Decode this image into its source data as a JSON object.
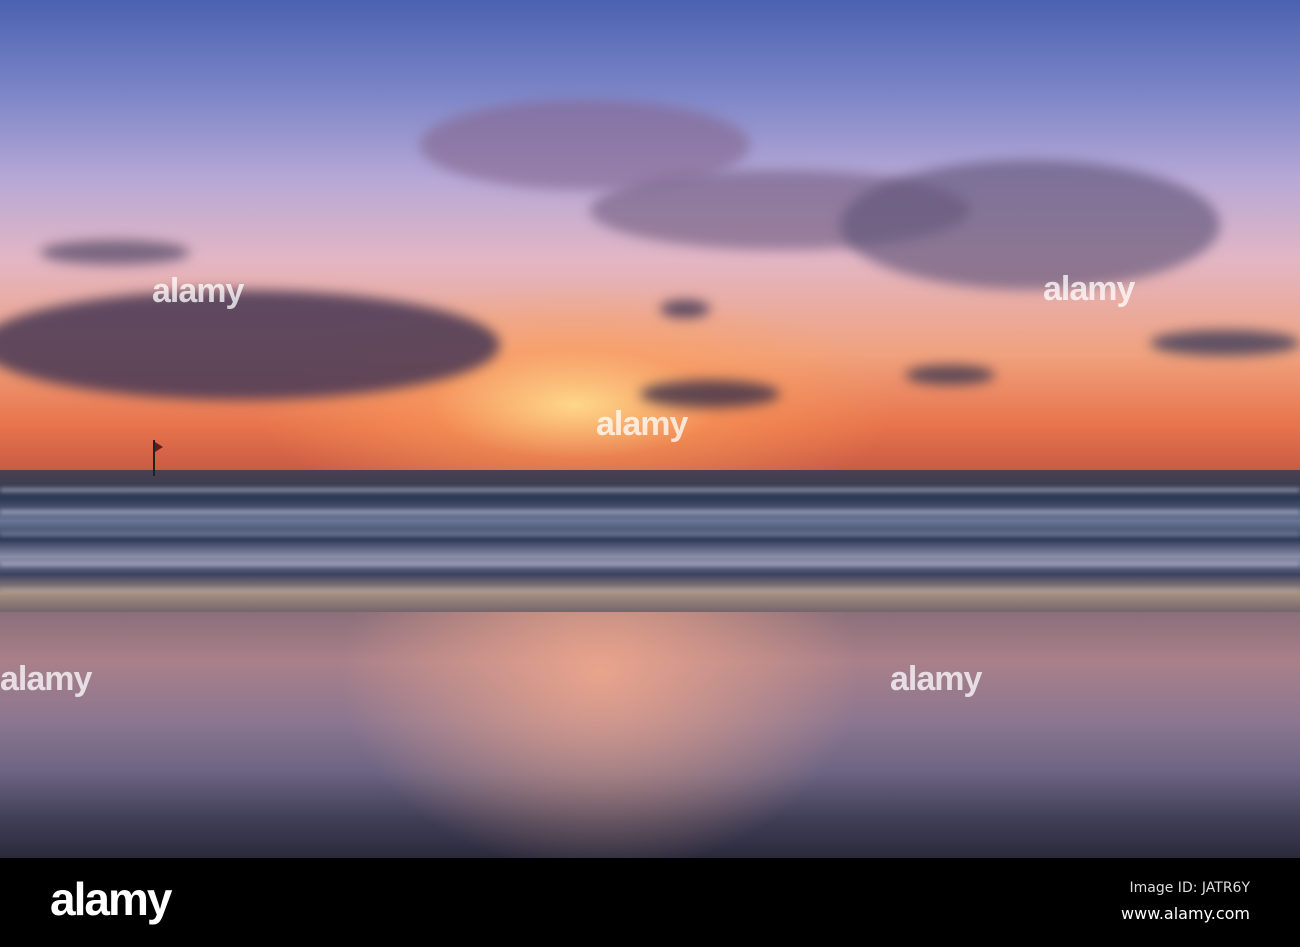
{
  "photo": {
    "subject": "Sunset over ocean beach with reflections",
    "watermark_text": "alamy"
  },
  "footer": {
    "logo": "alamy",
    "image_id": "Image ID: JATR6Y",
    "website": "www.alamy.com"
  }
}
